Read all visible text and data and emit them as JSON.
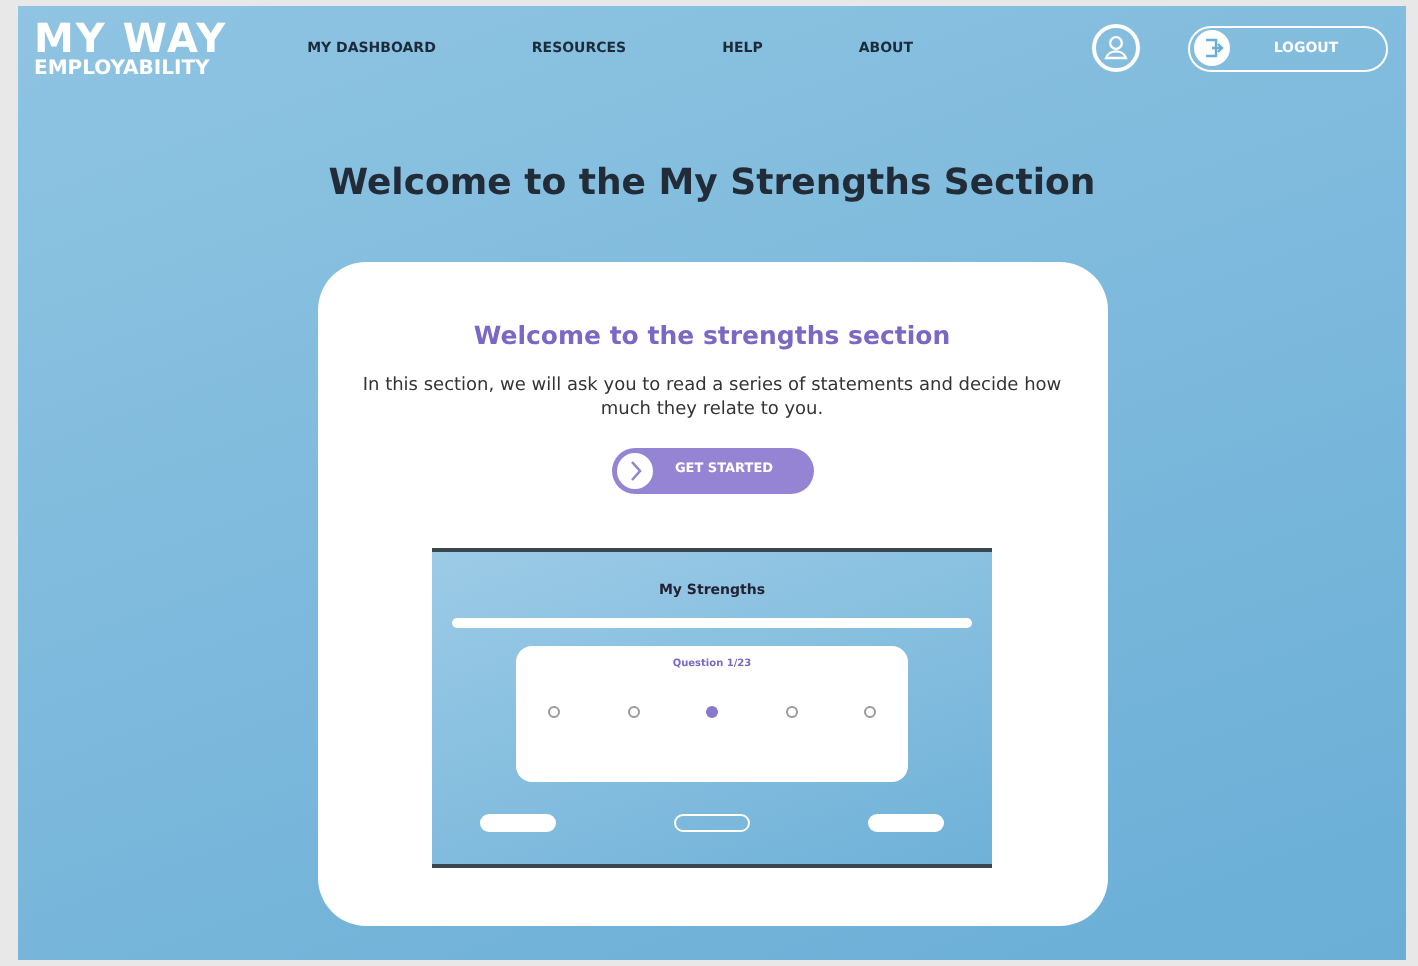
{
  "logo": {
    "top": "MY WAY",
    "bottom": "EMPLOYABILITY"
  },
  "nav": [
    {
      "label": "MY DASHBOARD"
    },
    {
      "label": "RESOURCES"
    },
    {
      "label": "HELP"
    },
    {
      "label": "ABOUT"
    }
  ],
  "logout": {
    "label": "LOGOUT"
  },
  "heading": "Welcome to the My Strengths Section",
  "card": {
    "title": "Welcome to the strengths section",
    "text": "In this section, we will ask you to read a series of statements and decide how much they relate to you.",
    "button": "GET STARTED"
  },
  "preview": {
    "title": "My Strengths",
    "question": "Question 1/23",
    "options": [
      {
        "selected": false
      },
      {
        "selected": false
      },
      {
        "selected": true
      },
      {
        "selected": false
      },
      {
        "selected": false
      }
    ]
  }
}
